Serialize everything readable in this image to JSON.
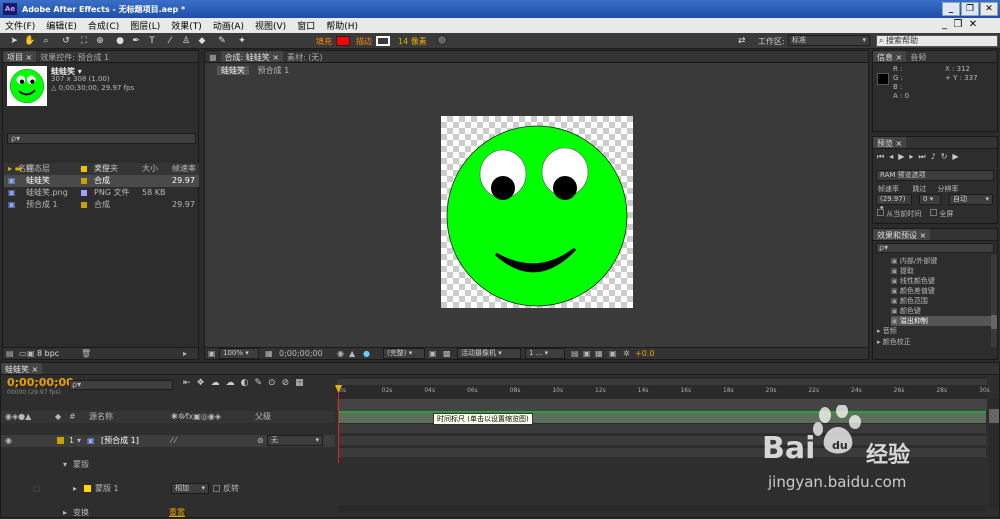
{
  "app": {
    "logo": "Ae",
    "title": "Adobe After Effects - 无标题项目.aep *"
  },
  "menu": [
    "文件(F)",
    "编辑(E)",
    "合成(C)",
    "图层(L)",
    "效果(T)",
    "动画(A)",
    "视图(V)",
    "窗口",
    "帮助(H)"
  ],
  "toolbar": {
    "fill_label": "填充",
    "stroke_label": "描边",
    "stroke_px": "14 像素",
    "workspace_label": "工作区:",
    "workspace_value": "标准",
    "search_placeholder": "搜索帮助",
    "fill_color": "#ff0000",
    "stroke_color": "#ffffff"
  },
  "project": {
    "tabs": [
      "项目 ×",
      "效果控件: 预合成 1"
    ],
    "item_name": "蛙蛙笑 ▾",
    "item_size": "307 x 308 (1.00)",
    "item_dur": "△ 0;00;30;00, 29.97 fps",
    "search": "ρ▾",
    "cols": [
      "名称",
      "类型",
      "大小",
      "帧速率"
    ],
    "rows": [
      {
        "name": "固态层",
        "type": "文件夹",
        "size": "",
        "fps": "",
        "color": "#e8c400",
        "icon": "folder-icon"
      },
      {
        "name": "蛙蛙笑",
        "type": "合成",
        "size": "",
        "fps": "29.97",
        "color": "#c8a000",
        "icon": "comp-icon"
      },
      {
        "name": "蛙蛙笑.png",
        "type": "PNG 文件",
        "size": "58 KB",
        "fps": "",
        "color": "#a0a0ff",
        "icon": "image-icon"
      },
      {
        "name": "预合成 1",
        "type": "合成",
        "size": "",
        "fps": "29.97",
        "color": "#c8a000",
        "icon": "comp-icon"
      }
    ],
    "bpc": "8 bpc"
  },
  "comp": {
    "tabs": [
      "合成: 蛙蛙笑 ×",
      "素材: (无)"
    ],
    "subtabs": [
      "蛙蛙笑",
      "预合成 1"
    ],
    "zoom": "100%",
    "time": "0;00;00;00",
    "res": "(完整)",
    "camera": "活动摄像机",
    "view": "1 ...",
    "exposure": "+0.0"
  },
  "info": {
    "tab": "信息 ×",
    "tab2": "音频",
    "r": "R :",
    "g": "G :",
    "b": "B :",
    "a": "A : 0",
    "x": "X : 312",
    "y": "+ Y : 337"
  },
  "preview": {
    "tab": "预览 ×",
    "ram": "RAM 预览选项",
    "fr_label": "帧速率",
    "skip_label": "跳过",
    "res_label": "分辨率",
    "fr": "(29.97)",
    "skip": "0",
    "res": "自动",
    "from_current": "从当前时间",
    "full": "全屏"
  },
  "effects": {
    "tab": "效果和预设 ×",
    "search": "ρ▾",
    "items": [
      "内部/外部键",
      "提取",
      "线性颜色键",
      "颜色差值键",
      "颜色范围",
      "颜色键",
      "溢出抑制"
    ],
    "groups": [
      "音频",
      "颜色校正"
    ]
  },
  "timeline": {
    "tab": "蛙蛙笑 ×",
    "time": "0;00;00;00",
    "fps": "00000 (29.97 fps)",
    "search": "ρ▾",
    "col_source": "源名称",
    "col_parent": "父级",
    "ticks": [
      "0s",
      "02s",
      "04s",
      "06s",
      "08s",
      "10s",
      "12s",
      "14s",
      "16s",
      "18s",
      "20s",
      "22s",
      "24s",
      "26s",
      "28s",
      "30s"
    ],
    "layer": {
      "num": "1",
      "name": "[预合成 1]",
      "parent": "无"
    },
    "mask_group": "蒙版",
    "mask": "蒙版 1",
    "mask_mode": "相加",
    "invert": "反转",
    "transform": "变换",
    "reset": "重置",
    "tooltip": "时间标尺 (单击以设置缩览图)"
  },
  "watermark": {
    "brand": "Bai",
    "brand2": "经验",
    "url": "jingyan.baidu.com"
  }
}
